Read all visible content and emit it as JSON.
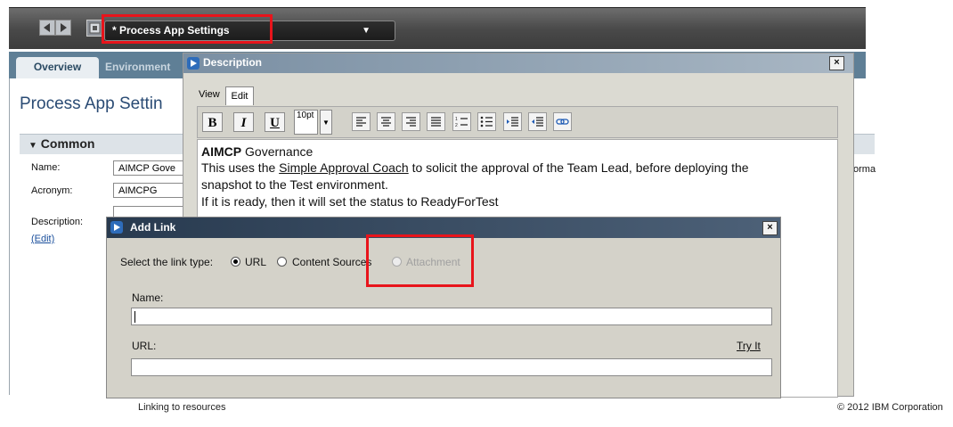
{
  "toolbar": {
    "back_icon": "left-arrow-icon",
    "forward_icon": "right-arrow-icon",
    "settings_icon": "settings-icon",
    "title": "* Process App Settings",
    "dropdown_icon": "chevron-down-icon"
  },
  "tabs": [
    {
      "label": "Overview",
      "active": true
    },
    {
      "label": "Environment",
      "active": false
    }
  ],
  "page": {
    "title": "Process App Settin",
    "section": "Common",
    "fields": {
      "name_label": "Name:",
      "name_value": "AIMCP Gove",
      "acronym_label": "Acronym:",
      "acronym_value": "AIMCPG",
      "description_label": "Description:",
      "edit_link": "(Edit)"
    },
    "right_clip_text": "orma"
  },
  "description_dialog": {
    "title": "Description",
    "close": "×",
    "tabs": [
      "View",
      "Edit"
    ],
    "active_tab": "Edit",
    "font_size": "10pt",
    "toolbar_buttons": [
      "B",
      "I",
      "U"
    ],
    "content": {
      "heading_bold": "AIMCP",
      "heading_rest": " Governance",
      "line2_pre": "This uses the ",
      "line2_link": "Simple Approval Coach",
      "line2_post": " to solicit the approval of the Team Lead, before deploying the",
      "line3": "snapshot to the Test environment.",
      "line4": "If it is ready, then it will set the status to ReadyForTest"
    }
  },
  "add_link_dialog": {
    "title": "Add Link",
    "close": "×",
    "link_type_label": "Select the link type:",
    "options": [
      {
        "label": "URL",
        "selected": true,
        "disabled": false
      },
      {
        "label": "Content Sources",
        "selected": false,
        "disabled": false
      },
      {
        "label": "Attachment",
        "selected": false,
        "disabled": true
      }
    ],
    "name_label": "Name:",
    "name_value": "",
    "url_label": "URL:",
    "url_value": "",
    "try_it": "Try It"
  },
  "footer": {
    "left": "Linking to resources",
    "right": "© 2012 IBM Corporation"
  },
  "colors": {
    "highlight": "#e8141b",
    "tab_bar": "#5f7f96",
    "dialog_title": "#283a4f"
  }
}
